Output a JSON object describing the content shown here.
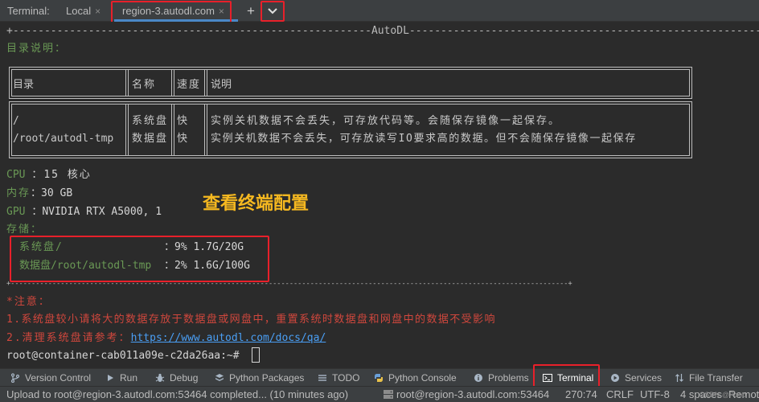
{
  "tabbar": {
    "label": "Terminal:",
    "tabs": [
      {
        "label": "Local",
        "close": "×"
      },
      {
        "label": "region-3.autodl.com",
        "close": "×"
      }
    ],
    "add_button": "+",
    "dropdown_icon": "chevron-down-icon"
  },
  "terminal": {
    "banner_left": "+---------------------------------------------------------",
    "banner_title": "AutoDL",
    "banner_right": "----------------------------------------------------------------------+",
    "dir_heading": "目录说明：",
    "table": {
      "headers": [
        "目录",
        "名称",
        "速度",
        "说明"
      ],
      "rows": [
        [
          "/",
          "系统盘",
          "快",
          "实例关机数据不会丢失，可存放代码等。会随保存镜像一起保存。"
        ],
        [
          "/root/autodl-tmp",
          "数据盘",
          "快",
          "实例关机数据不会丢失，可存放读写IO要求高的数据。但不会随保存镜像一起保存"
        ]
      ]
    },
    "cpu_label": "CPU",
    "cpu_value": "：15 核心",
    "mem_label": "内存",
    "mem_value": "：30 GB",
    "gpu_label": "GPU",
    "gpu_value": "：NVIDIA RTX A5000, 1",
    "storage_label": "存储：",
    "storage_sys_label": "系统盘/",
    "storage_sys_value": "：9% 1.7G/20G",
    "storage_data_label": "数据盘/root/autodl-tmp",
    "storage_data_value": "：2% 1.6G/100G",
    "rule_bottom": "+--------------------------------------------------------------------------------------------------------------------------------------+",
    "note_heading": "*注意：",
    "note_1": "1.系统盘较小请将大的数据存放于数据盘或网盘中，重置系统时数据盘和网盘中的数据不受影响",
    "note_2_prefix": "2.清理系统盘请参考：",
    "note_2_link": "https://www.autodl.com/docs/qa/",
    "prompt": "root@container-cab011a09e-c2da26aa:~#",
    "annotation": "查看终端配置"
  },
  "toolwindows": [
    {
      "label": "Version Control",
      "icon": "branch-icon"
    },
    {
      "label": "Run",
      "icon": "play-icon"
    },
    {
      "label": "Debug",
      "icon": "bug-icon"
    },
    {
      "label": "Python Packages",
      "icon": "layers-icon"
    },
    {
      "label": "TODO",
      "icon": "list-icon"
    },
    {
      "label": "Python Console",
      "icon": "python-icon"
    },
    {
      "label": "Problems",
      "icon": "info-icon"
    },
    {
      "label": "Terminal",
      "icon": "terminal-icon"
    },
    {
      "label": "Services",
      "icon": "services-icon"
    },
    {
      "label": "File Transfer",
      "icon": "transfer-icon"
    }
  ],
  "statusbar": {
    "message": "Upload to root@region-3.autodl.com:53464 completed... (10 minutes ago)",
    "connection": "root@region-3.autodl.com:53464",
    "position": "270:74",
    "line_sep": "CRLF",
    "encoding": "UTF-8",
    "indent": "4 spaces",
    "remote": "Remot"
  },
  "watermark": "CSDN @Pooo"
}
